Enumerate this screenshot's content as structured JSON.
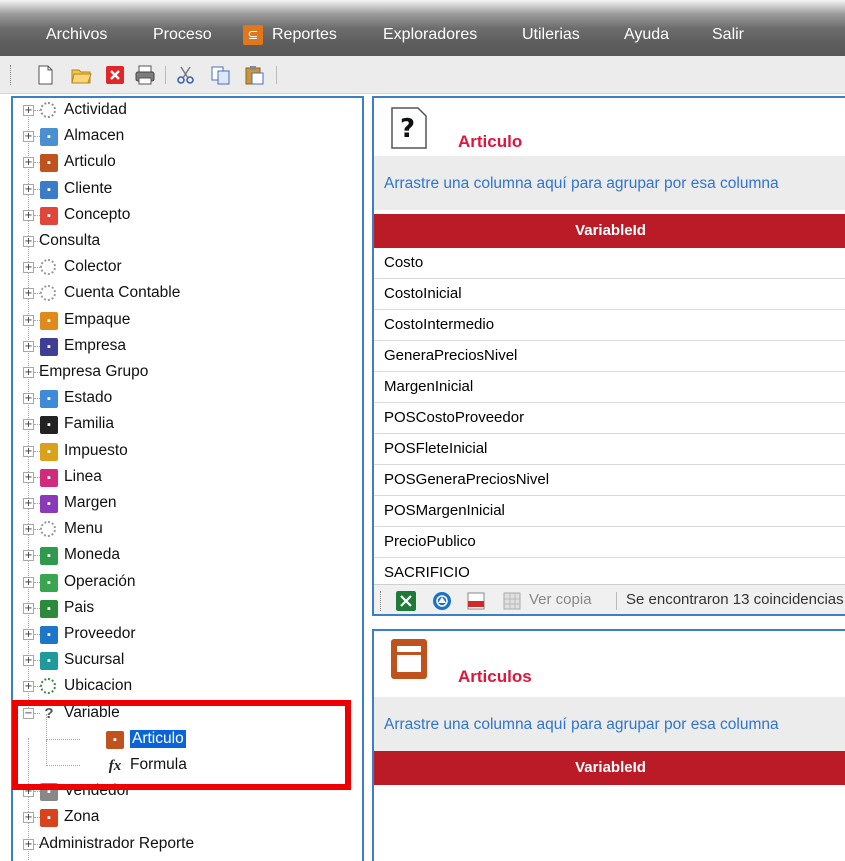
{
  "menu": {
    "items": [
      "Archivos",
      "Proceso",
      "Reportes",
      "Exploradores",
      "Utilerias",
      "Ayuda",
      "Salir"
    ]
  },
  "toolbar": {
    "icons": [
      "new-icon",
      "open-folder-icon",
      "close-icon",
      "print-icon",
      "cut-icon",
      "copy-icon",
      "paste-icon"
    ]
  },
  "tree": {
    "items": [
      {
        "label": "Actividad",
        "icon": "gear-icon",
        "color": "#8f8f8f"
      },
      {
        "label": "Almacen",
        "icon": "warehouse-icon",
        "color": "#4a8fd0"
      },
      {
        "label": "Articulo",
        "icon": "box-icon",
        "color": "#c0531d"
      },
      {
        "label": "Cliente",
        "icon": "person-icon",
        "color": "#3a7cc8"
      },
      {
        "label": "Concepto",
        "icon": "puzzle-icon",
        "color": "#e0473a"
      },
      {
        "label": "Consulta",
        "icon": "",
        "color": ""
      },
      {
        "label": "Colector",
        "icon": "gear-icon",
        "color": "#9a9a9a"
      },
      {
        "label": "Cuenta Contable",
        "icon": "gear-icon",
        "color": "#9a9a9a"
      },
      {
        "label": "Empaque",
        "icon": "package-icon",
        "color": "#e08a1c"
      },
      {
        "label": "Empresa",
        "icon": "building-icon",
        "color": "#3e3e96"
      },
      {
        "label": "Empresa Grupo",
        "icon": "",
        "color": ""
      },
      {
        "label": "Estado",
        "icon": "globe-icon",
        "color": "#3c8ad8"
      },
      {
        "label": "Familia",
        "icon": "tree-diagram-icon",
        "color": "#222222"
      },
      {
        "label": "Impuesto",
        "icon": "coins-icon",
        "color": "#d9a21a"
      },
      {
        "label": "Linea",
        "icon": "grid-icon",
        "color": "#d22a7d"
      },
      {
        "label": "Margen",
        "icon": "list-icon",
        "color": "#8a3ab8"
      },
      {
        "label": "Menu",
        "icon": "menu-icon",
        "color": "#9a9a9a"
      },
      {
        "label": "Moneda",
        "icon": "money-icon",
        "color": "#2f9a4e"
      },
      {
        "label": "Operación",
        "icon": "plus-circle-icon",
        "color": "#3aa54f"
      },
      {
        "label": "Pais",
        "icon": "flag-icon",
        "color": "#2c8a3a"
      },
      {
        "label": "Proveedor",
        "icon": "truck-icon",
        "color": "#1f76c8"
      },
      {
        "label": "Sucursal",
        "icon": "store-icon",
        "color": "#1f9a9a"
      },
      {
        "label": "Ubicacion",
        "icon": "map-pin-icon",
        "color": "#3a8a3a"
      },
      {
        "label": "Variable",
        "icon": "question-icon",
        "color": "#555555"
      },
      {
        "label": "Articulo",
        "icon": "box-icon",
        "color": "#c0531d"
      },
      {
        "label": "Formula",
        "icon": "function-icon",
        "color": "#222222"
      },
      {
        "label": "Vendedor",
        "icon": "person-icon",
        "color": "#888888"
      },
      {
        "label": "Zona",
        "icon": "alert-icon",
        "color": "#d8431c"
      },
      {
        "label": "Administrador Reporte",
        "icon": "",
        "color": ""
      }
    ]
  },
  "panel1": {
    "title": "Articulo",
    "icon": "question-icon",
    "group_hint": "Arrastre una columna aquí para agrupar por esa columna",
    "column": "VariableId",
    "rows": [
      "Costo",
      "CostoInicial",
      "CostoIntermedio",
      "GeneraPreciosNivel",
      "MargenInicial",
      "POSCostoProveedor",
      "POSFleteInicial",
      "POSGeneraPreciosNivel",
      "POSMargenInicial",
      "PrecioPublico",
      "SACRIFICIO"
    ],
    "footer": {
      "ver_copia": "Ver copia",
      "status": "Se encontraron 13 coincidencias"
    }
  },
  "panel2": {
    "title": "Articulos",
    "icon": "box-icon",
    "group_hint": "Arrastre una columna aquí para agrupar por esa columna",
    "column": "VariableId"
  },
  "colors": {
    "accent_red": "#bb1a27",
    "title_red": "#e0143c",
    "link_blue": "#2f74d0",
    "selection": "#0a64d8",
    "highlight": "#ee0000"
  }
}
